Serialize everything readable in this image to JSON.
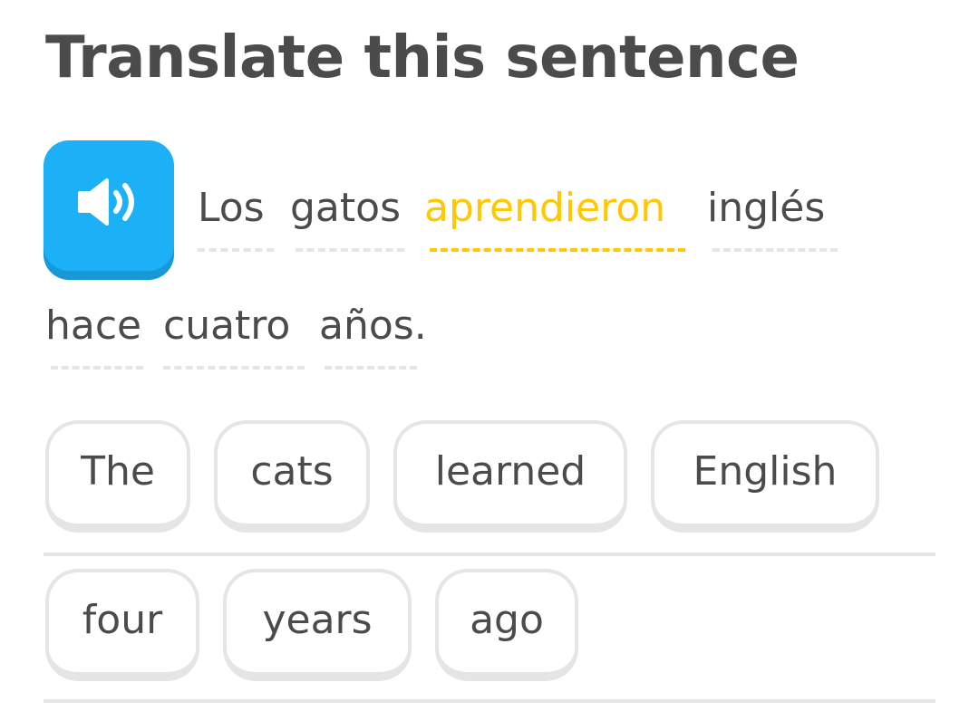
{
  "heading": "Translate this sentence",
  "speaker": {
    "icon": "speaker-icon",
    "color": "#1cb0f6"
  },
  "prompt": {
    "words": [
      "Los",
      "gatos",
      "aprendieron",
      "inglés",
      "hace",
      "cuatro",
      "años."
    ],
    "highlighted_word": "aprendieron",
    "highlight_color": "#ffc800"
  },
  "answer_line": [
    "The",
    "cats",
    "learned",
    "English"
  ],
  "word_bank": [
    "four",
    "years",
    "ago"
  ]
}
